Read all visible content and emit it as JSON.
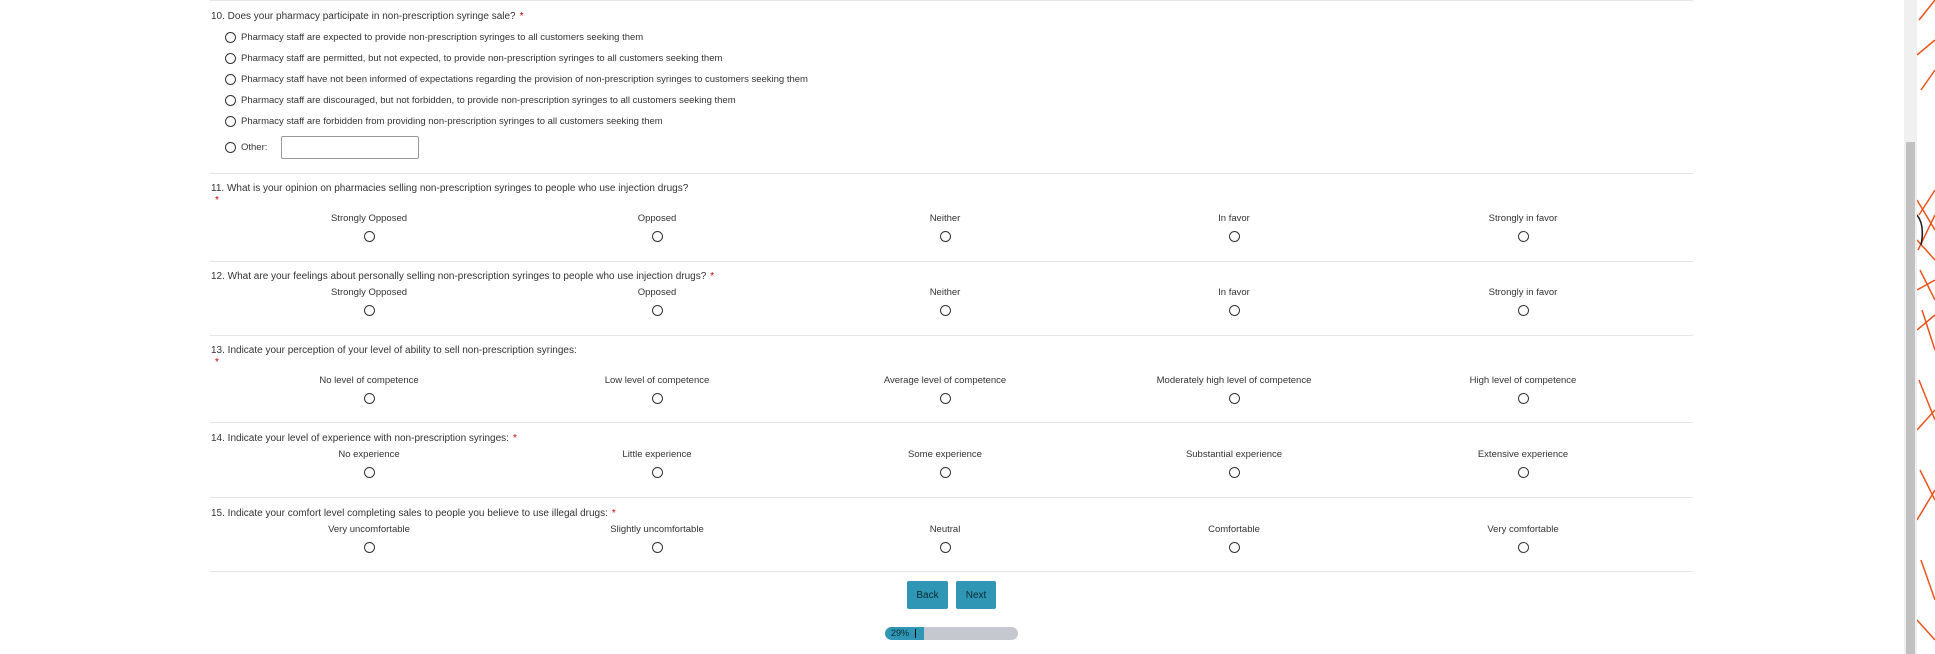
{
  "q10": {
    "text": "10. Does your pharmacy participate in non-prescription syringe sale?",
    "required": "*",
    "options": [
      "Pharmacy staff are expected to provide non-prescription syringes to all customers seeking them",
      "Pharmacy staff are permitted, but not expected, to provide non-prescription syringes to all customers seeking them",
      "Pharmacy staff have not been informed of expectations regarding the provision of non-prescription syringes to customers seeking them",
      "Pharmacy staff are discouraged, but not forbidden, to provide non-prescription syringes to all customers seeking them",
      "Pharmacy staff are forbidden from providing non-prescription syringes to all customers seeking them"
    ],
    "other_label": "Other:",
    "other_value": ""
  },
  "q11": {
    "text": "11. What is your opinion on pharmacies selling non-prescription syringes to people who use injection drugs?",
    "required": "*",
    "scale": [
      "Strongly Opposed",
      "Opposed",
      "Neither",
      "In favor",
      "Strongly in favor"
    ]
  },
  "q12": {
    "text": "12. What are your feelings about personally selling non-prescription syringes to people who use injection drugs?",
    "required": "*",
    "scale": [
      "Strongly Opposed",
      "Opposed",
      "Neither",
      "In favor",
      "Strongly in favor"
    ]
  },
  "q13": {
    "text": "13. Indicate your perception of your level of ability to sell non-prescription syringes:",
    "required": "*",
    "scale": [
      "No level of competence",
      "Low level of competence",
      "Average level of competence",
      "Moderately high level of competence",
      "High level of competence"
    ]
  },
  "q14": {
    "text": "14. Indicate your level of experience with non-prescription syringes:",
    "required": "*",
    "scale": [
      "No experience",
      "Little experience",
      "Some experience",
      "Substantial experience",
      "Extensive experience"
    ]
  },
  "q15": {
    "text": "15. Indicate your comfort level completing sales to people you believe to use illegal drugs:",
    "required": "*",
    "scale": [
      "Very uncomfortable",
      "Slightly uncomfortable",
      "Neutral",
      "Comfortable",
      "Very comfortable"
    ]
  },
  "nav": {
    "back_label": "Back",
    "next_label": "Next"
  },
  "progress": {
    "text": "29%",
    "value": 0.29
  },
  "colors": {
    "button": "#2f96b5",
    "required": "#cc0000",
    "progress_track": "#c5c9cf",
    "decoration": "#e8541c"
  }
}
